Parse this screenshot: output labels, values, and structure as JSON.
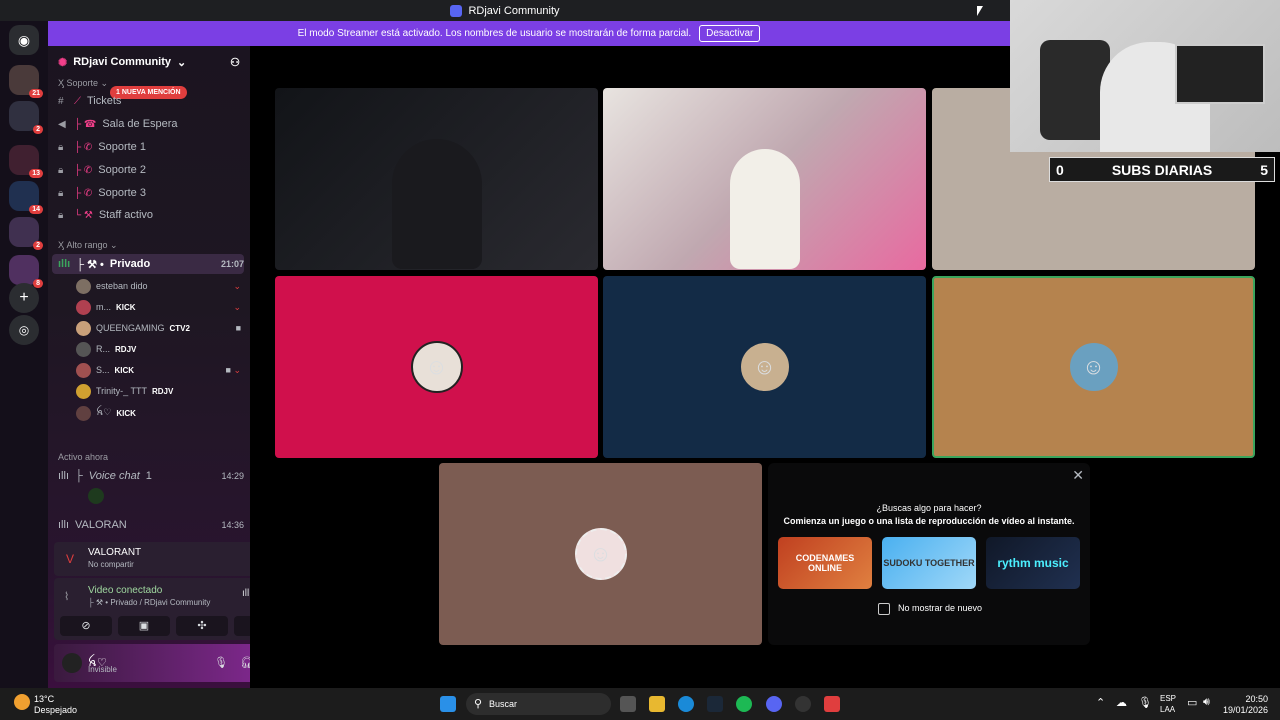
{
  "window": {
    "title": "RDjavi Community"
  },
  "streamer_banner": {
    "text": "El modo Streamer está activado. Los nombres de usuario se mostrarán de forma parcial.",
    "button": "Desactivar"
  },
  "guilds": [
    {
      "badge": "21"
    },
    {
      "badge": "2"
    },
    {
      "badge": "13"
    },
    {
      "badge": "14"
    },
    {
      "badge": "2"
    },
    {
      "badge": "8"
    }
  ],
  "server": {
    "name": "RDjavi Community"
  },
  "mention": "1 NUEVA MENCIÓN",
  "categories": {
    "soporte": "Soporte",
    "alto_rango": "Alto rango",
    "activo": "Activo ahora"
  },
  "channels": [
    {
      "name": "Tickets"
    },
    {
      "name": "Sala de Espera"
    },
    {
      "name": "Soporte 1"
    },
    {
      "name": "Soporte 2"
    },
    {
      "name": "Soporte 3"
    },
    {
      "name": "Staff activo"
    }
  ],
  "active_channel": {
    "name": "Privado",
    "time": "21:07"
  },
  "users": [
    {
      "name": "esteban dido",
      "tag": ""
    },
    {
      "name": "m...",
      "tag": "KICK"
    },
    {
      "name": "QUEENGAMING",
      "tag": "CTV2"
    },
    {
      "name": "R...",
      "tag": "RDJV"
    },
    {
      "name": "S...",
      "tag": "KICK"
    },
    {
      "name": "Trinity-_ TTT",
      "tag": "RDJV"
    },
    {
      "name": "ꫝ♡",
      "tag": "KICK"
    }
  ],
  "voice_chat": {
    "name": "Voice chat",
    "count": "1",
    "time": "14:29"
  },
  "valoran": {
    "name": "VALORAN",
    "time": "14:36"
  },
  "activity": {
    "game": "VALORANT",
    "sub": "No compartir"
  },
  "video": {
    "status": "Video conectado",
    "path": "Privado / RDjavi Community"
  },
  "me": {
    "name": "ꫝ♡",
    "status": "Invisible"
  },
  "activities_panel": {
    "title": "¿Buscas algo para hacer?",
    "subtitle": "Comienza un juego o una lista de reproducción de vídeo al instante.",
    "games": [
      "CODENAMES ONLINE",
      "SUDOKU TOGETHER",
      "rythm music"
    ],
    "checkbox": "No mostrar de nuevo"
  },
  "overlay": {
    "left": "0",
    "label": "SUBS DIARIAS",
    "right": "5"
  },
  "taskbar": {
    "temp": "13°C",
    "weather": "Despejado",
    "search": "Buscar",
    "lang1": "ESP",
    "lang2": "LAA",
    "time": "20:50",
    "date": "19/01/2026"
  },
  "colors": {
    "banner": "#7b3fe4",
    "tile_red": "#d0104c",
    "tile_blue": "#132b46",
    "tile_orange": "#b5834e",
    "tile_mauve": "#7c5c52"
  }
}
